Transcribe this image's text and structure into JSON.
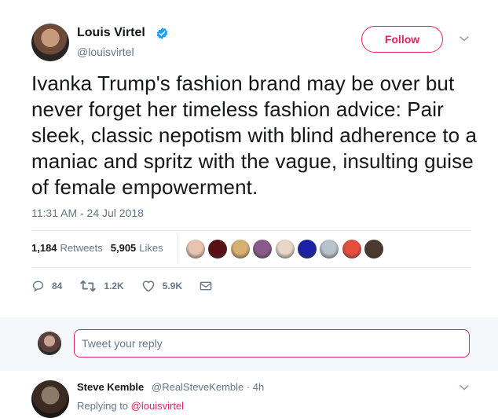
{
  "tweet": {
    "author_name": "Louis Virtel",
    "author_handle": "@louisvirtel",
    "follow_label": "Follow",
    "text": "Ivanka Trump's fashion brand may be over but never forget her timeless fashion advice: Pair sleek, classic nepotism with blind adherence to a maniac and spritz with the vague, insulting guise of female empowerment.",
    "timestamp": "11:31 AM - 24 Jul 2018",
    "retweet_count": "1,184",
    "retweet_label": "Retweets",
    "like_count": "5,905",
    "like_label": "Likes",
    "liker_colors": [
      "#e8c4b0",
      "#5a0f14",
      "#d8b070",
      "#8a5a8a",
      "#e9d6c8",
      "#1b22a8",
      "#b8c2cc",
      "#e64f3c",
      "#4a3a30"
    ],
    "actions": {
      "reply_count": "84",
      "retweet_count": "1.2K",
      "like_count": "5.9K"
    },
    "icons": {
      "verified": "verified-badge-icon",
      "caret": "chevron-down-icon",
      "reply": "reply-icon",
      "retweet": "retweet-icon",
      "like": "heart-icon",
      "message": "envelope-icon"
    },
    "colors": {
      "accent": "#e0245e",
      "verified": "#1da1f2",
      "muted": "#657786"
    }
  },
  "reply_composer": {
    "placeholder": "Tweet your reply"
  },
  "reply": {
    "author_name": "Steve Kemble",
    "author_handle_time": "@RealSteveKemble · 4h",
    "replying_prefix": "Replying to",
    "replying_handle": "@louisvirtel"
  }
}
